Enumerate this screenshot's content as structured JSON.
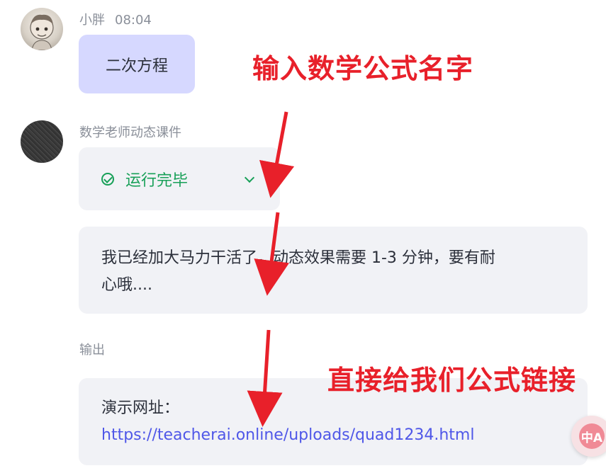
{
  "conversation": {
    "user_message": {
      "sender": "小胖",
      "time": "08:04",
      "text": "二次方程"
    },
    "bot_message": {
      "sender": "数学老师动态课件",
      "status_label": "运行完毕",
      "message_line1": "我已经加大马力干活了，动态效果需要 1-3 分钟，要有耐",
      "message_line2": "心哦....",
      "output_label": "输出",
      "output_prefix": "演示网址：",
      "output_link": "https://teacherai.online/uploads/quad1234.html"
    }
  },
  "annotations": {
    "top": "输入数学公式名字",
    "bottom": "直接给我们公式链接"
  },
  "fab": {
    "glyph": "中A"
  },
  "colors": {
    "annotation_red": "#e8202a",
    "status_green": "#18a058",
    "link_blue": "#4f57e8",
    "user_bubble": "#d6d8ff",
    "bot_bubble": "#f1f2f6"
  },
  "icons": [
    "user-avatar",
    "bot-avatar",
    "check-circle-icon",
    "chevron-down-icon",
    "translate-fab-icon"
  ]
}
